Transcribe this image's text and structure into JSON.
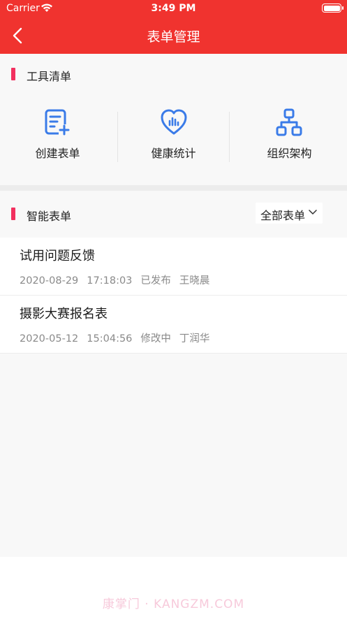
{
  "status_bar": {
    "carrier": "Carrier",
    "time": "3:49 PM"
  },
  "nav": {
    "title": "表单管理"
  },
  "tools_section": {
    "title": "工具清单",
    "items": [
      {
        "label": "创建表单",
        "icon": "create-form-icon"
      },
      {
        "label": "健康统计",
        "icon": "health-heart-icon"
      },
      {
        "label": "组织架构",
        "icon": "org-chart-icon"
      }
    ]
  },
  "forms_section": {
    "title": "智能表单",
    "filter": {
      "selected": "全部表单"
    },
    "items": [
      {
        "name": "试用问题反馈",
        "date": "2020-08-29",
        "time": "17:18:03",
        "status": "已发布",
        "author": "王晓晨"
      },
      {
        "name": "摄影大赛报名表",
        "date": "2020-05-12",
        "time": "15:04:56",
        "status": "修改中",
        "author": "丁润华"
      }
    ]
  },
  "watermark": "康掌门 · KANGZM.COM",
  "colors": {
    "header": "#f0332f",
    "accent_bar": "#f2305f",
    "icon_blue": "#3a7be8"
  }
}
